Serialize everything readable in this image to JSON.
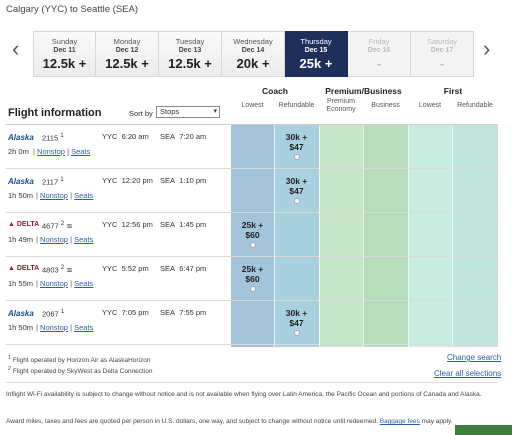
{
  "route": "Calgary (YYC) to Seattle (SEA)",
  "dates": [
    {
      "dow": "Sunday",
      "date": "Dec 11",
      "price": "12.5k +",
      "state": "normal"
    },
    {
      "dow": "Monday",
      "date": "Dec 12",
      "price": "12.5k +",
      "state": "normal"
    },
    {
      "dow": "Tuesday",
      "date": "Dec 13",
      "price": "12.5k +",
      "state": "normal"
    },
    {
      "dow": "Wednesday",
      "date": "Dec 14",
      "price": "20k +",
      "state": "normal"
    },
    {
      "dow": "Thursday",
      "date": "Dec 15",
      "price": "25k +",
      "state": "selected"
    },
    {
      "dow": "Friday",
      "date": "Dec 16",
      "price": "-",
      "state": "disabled"
    },
    {
      "dow": "Saturday",
      "date": "Dec 17",
      "price": "-",
      "state": "disabled"
    }
  ],
  "nav": {
    "prev": "‹",
    "next": "›"
  },
  "table": {
    "title": "Flight information",
    "sort_label": "Sort by",
    "sort_value": "Stops",
    "cabins": {
      "coach": "Coach",
      "premium": "Premium/Business",
      "first": "First",
      "lowest": "Lowest",
      "refundable": "Refundable",
      "premium_economy": "Premium Economy",
      "business": "Business",
      "first_lowest": "Lowest",
      "first_refundable": "Refundable"
    }
  },
  "flights": [
    {
      "airline": "Alaska",
      "flight": "2115",
      "note": "1",
      "dep_airport": "YYC",
      "dep_time": "6:20 am",
      "arr_airport": "SEA",
      "arr_time": "7:20 am",
      "duration": "2h 0m",
      "stops": "Nonstop",
      "seats": "Seats",
      "fare_col": "refundable",
      "fare_miles": "30k +",
      "fare_fee": "$47"
    },
    {
      "airline": "Alaska",
      "flight": "2117",
      "note": "1",
      "dep_airport": "YYC",
      "dep_time": "12:20 pm",
      "arr_airport": "SEA",
      "arr_time": "1:10 pm",
      "duration": "1h 50m",
      "stops": "Nonstop",
      "seats": "Seats",
      "fare_col": "refundable",
      "fare_miles": "30k +",
      "fare_fee": "$47"
    },
    {
      "airline": "DELTA",
      "flight": "4677",
      "note": "2",
      "dep_airport": "YYC",
      "dep_time": "12:56 pm",
      "arr_airport": "SEA",
      "arr_time": "1:45 pm",
      "duration": "1h 49m",
      "stops": "Nonstop",
      "seats": "Seats",
      "fare_col": "lowest",
      "fare_miles": "25k +",
      "fare_fee": "$60"
    },
    {
      "airline": "DELTA",
      "flight": "4803",
      "note": "2",
      "dep_airport": "YYC",
      "dep_time": "5:52 pm",
      "arr_airport": "SEA",
      "arr_time": "6:47 pm",
      "duration": "1h 55m",
      "stops": "Nonstop",
      "seats": "Seats",
      "fare_col": "lowest",
      "fare_miles": "25k +",
      "fare_fee": "$60"
    },
    {
      "airline": "Alaska",
      "flight": "2067",
      "note": "1",
      "dep_airport": "YYC",
      "dep_time": "7:05 pm",
      "arr_airport": "SEA",
      "arr_time": "7:55 pm",
      "duration": "1h 50m",
      "stops": "Nonstop",
      "seats": "Seats",
      "fare_col": "refundable",
      "fare_miles": "30k +",
      "fare_fee": "$47"
    }
  ],
  "footnotes": {
    "note1": "Flight operated by Horizon Air as AlaskaHorizon",
    "note2": "Flight operated by SkyWest as Delta Connection",
    "change_search": "Change search",
    "clear_selections": "Clear all selections",
    "wifi": "Inflight Wi-Fi availability is subject to change without notice and is not available when flying over Latin America, the Pacific Ocean and portions of Canada and Alaska.",
    "fees_prefix": "Award miles, taxes and fees are quoted per person in U.S. dollars, one way, and subject to change without notice until redeemed.",
    "baggage_link": "Baggage fees",
    "fees_suffix": "may apply."
  },
  "colors": {
    "selected_date": "#1e2f5c",
    "link": "#2a5fa6",
    "coach": "#a3c4d9",
    "premium": "#c7e5c7",
    "first": "#c8ecdf"
  }
}
